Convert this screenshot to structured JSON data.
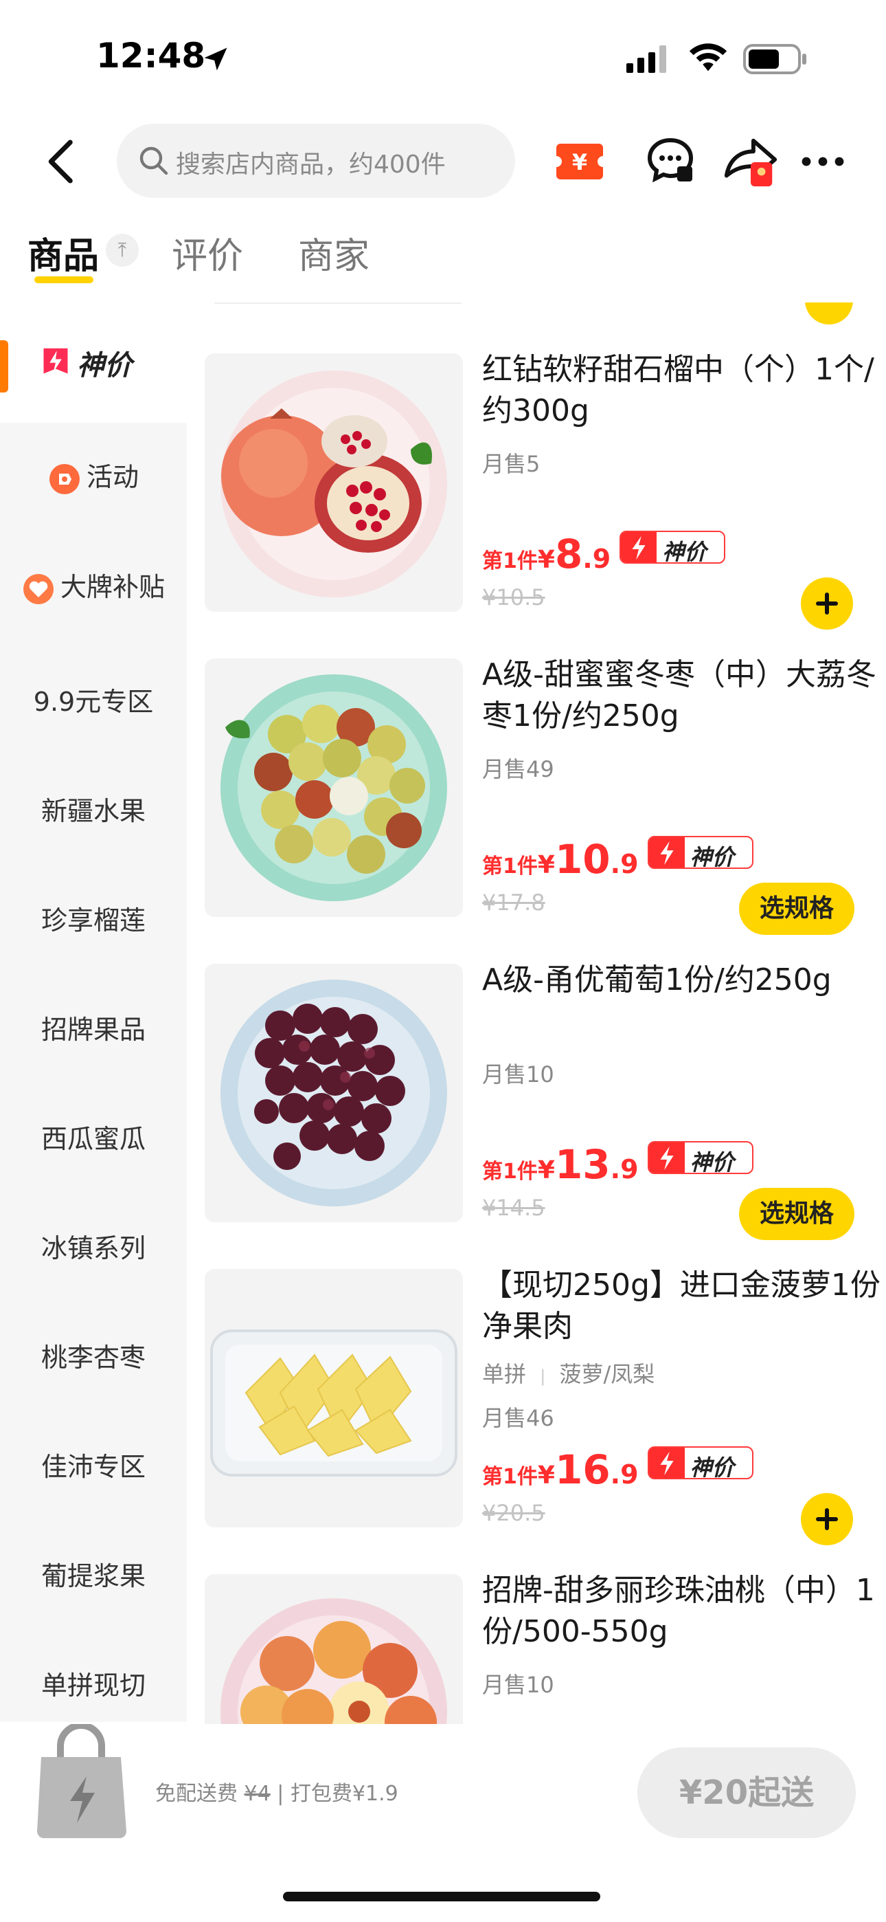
{
  "status_bar": {
    "time": "12:48"
  },
  "nav": {
    "search_placeholder": "搜索店内商品，约400件",
    "coupon_symbol": "¥"
  },
  "tabs": [
    {
      "label": "商品",
      "active": true
    },
    {
      "label": "评价",
      "active": false
    },
    {
      "label": "商家",
      "active": false
    }
  ],
  "tab_top_symbol": "⤒",
  "sidebar": {
    "active": "神价",
    "items": [
      {
        "label": "活动",
        "icon": "tag-icon"
      },
      {
        "label": "大牌补贴",
        "icon": "heart-badge-icon"
      },
      {
        "label": "9.9元专区"
      },
      {
        "label": "新疆水果"
      },
      {
        "label": "珍享榴莲"
      },
      {
        "label": "招牌果品"
      },
      {
        "label": "西瓜蜜瓜"
      },
      {
        "label": "冰镇系列"
      },
      {
        "label": "桃李杏枣"
      },
      {
        "label": "佳沛专区"
      },
      {
        "label": "葡提浆果"
      },
      {
        "label": "单拼现切"
      }
    ]
  },
  "products": [
    {
      "name": "红钻软籽甜石榴中（个）1个/约300g",
      "sales": "月售5",
      "price_prefix": "第1件",
      "price_yen": "¥",
      "price_int": "8",
      "price_dec": ".9",
      "badge": "神价",
      "old_price": "¥10.5",
      "action": "add"
    },
    {
      "name": "A级-甜蜜蜜冬枣（中）大荔冬枣1份/约250g",
      "sales": "月售49",
      "price_prefix": "第1件",
      "price_yen": "¥",
      "price_int": "10",
      "price_dec": ".9",
      "badge": "神价",
      "old_price": "¥17.8",
      "action": "选规格"
    },
    {
      "name": "A级-甬优葡萄1份/约250g",
      "sales": "月售10",
      "price_prefix": "第1件",
      "price_yen": "¥",
      "price_int": "13",
      "price_dec": ".9",
      "badge": "神价",
      "old_price": "¥14.5",
      "action": "选规格"
    },
    {
      "name": "【现切250g】进口金菠萝1份净果肉",
      "tags": [
        "单拼",
        "菠萝/凤梨"
      ],
      "sales": "月售46",
      "price_prefix": "第1件",
      "price_yen": "¥",
      "price_int": "16",
      "price_dec": ".9",
      "badge": "神价",
      "old_price": "¥20.5",
      "action": "add"
    },
    {
      "name": "招牌-甜多丽珍珠油桃（中）1份/500-550g",
      "sales": "月售10"
    }
  ],
  "bottom_bar": {
    "free_delivery": "免配送费",
    "delivery_old": "¥4",
    "separator": "|",
    "packing_fee": "打包费¥1.9",
    "min_order": "¥20起送"
  },
  "colors": {
    "accent_yellow": "#ffd500",
    "price_red": "#ff2d2d",
    "sidebar_bg": "#f6f6f6",
    "active_bar": "#ff7a00"
  }
}
